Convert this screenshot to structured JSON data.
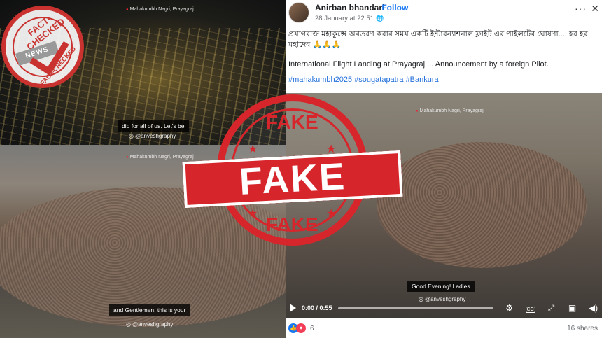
{
  "post": {
    "author": "Anirban bhandari",
    "follow": "Follow",
    "date": "28 January at 22:51",
    "more": "···",
    "close": "✕",
    "body_bengali": "প্রয়াগরাজ মহাকুম্ভে অবতরণ করার সময় একটি ইন্টারন্যাশনাল ফ্লাইট এর পাইলটের ঘোষণা.... হর হর মহাদেব 🙏🙏🙏",
    "body_english": "International Flight Landing at Prayagraj  ... Announcement  by a foreign Pilot.",
    "hashtags": "#mahakumbh2025 #sougatapatra #Bankura"
  },
  "media": {
    "location": "Mahakumbh Nagri, Prayagraj",
    "watermark": "@anveshgraphy",
    "caption_top_left": "dip for all of us. Let's be",
    "caption_bottom_left": "and Gentlemen, this is your",
    "caption_right": "Good Evening! Ladies"
  },
  "video": {
    "time": "0:00 / 0:55"
  },
  "footer": {
    "reaction_count": "6",
    "shares": "16 shares"
  },
  "stamps": {
    "fact_checked": "FACT-CHECKED",
    "fact_checked_brand": "NEWS",
    "fake_big": "FAKE",
    "fake_top": "FAKE",
    "fake_bottom": "FAKE"
  },
  "colors": {
    "stamp_red": "#d7262b",
    "facebook_blue": "#1877f2",
    "hashtag_blue": "#216fdb"
  }
}
